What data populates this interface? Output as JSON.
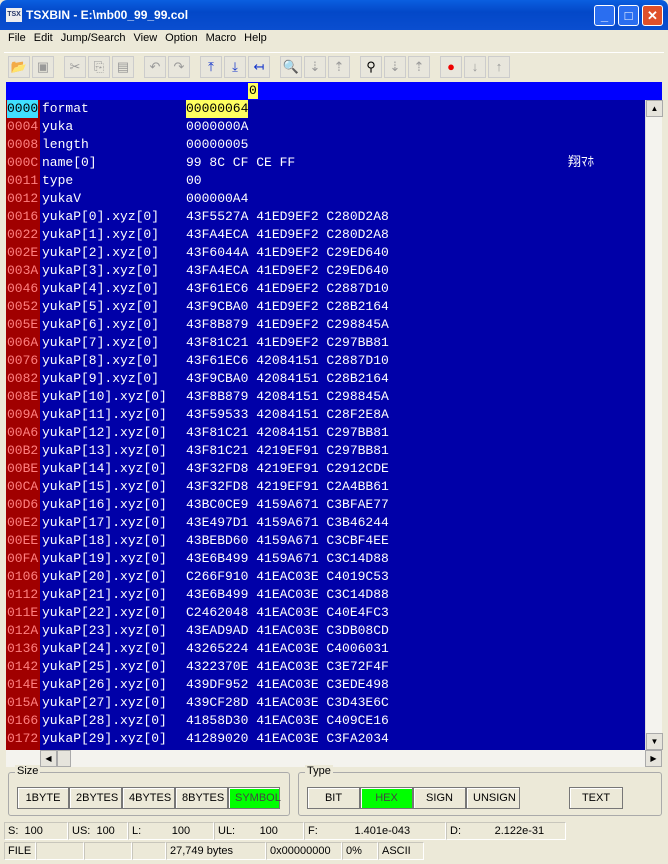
{
  "window": {
    "title": "TSXBIN - E:\\mb00_99_99.col",
    "logo": "TSX"
  },
  "menu": [
    "File",
    "Edit",
    "Jump/Search",
    "View",
    "Option",
    "Macro",
    "Help"
  ],
  "ruler": {
    "column": "0"
  },
  "rows": [
    {
      "addr": "0000",
      "name": "format",
      "value": "00000064"
    },
    {
      "addr": "0004",
      "name": "yuka",
      "value": "0000000A"
    },
    {
      "addr": "0008",
      "name": "length",
      "value": "00000005"
    },
    {
      "addr": "000C",
      "name": "name[0]",
      "value": "99 8C CF CE FF",
      "ascii": "翔ﾏﾎ"
    },
    {
      "addr": "0011",
      "name": "type",
      "value": "00"
    },
    {
      "addr": "0012",
      "name": "yukaV",
      "value": "000000A4"
    },
    {
      "addr": "0016",
      "name": "yukaP[0].xyz[0]",
      "value": "43F5527A 41ED9EF2 C280D2A8"
    },
    {
      "addr": "0022",
      "name": "yukaP[1].xyz[0]",
      "value": "43FA4ECA 41ED9EF2 C280D2A8"
    },
    {
      "addr": "002E",
      "name": "yukaP[2].xyz[0]",
      "value": "43F6044A 41ED9EF2 C29ED640"
    },
    {
      "addr": "003A",
      "name": "yukaP[3].xyz[0]",
      "value": "43FA4ECA 41ED9EF2 C29ED640"
    },
    {
      "addr": "0046",
      "name": "yukaP[4].xyz[0]",
      "value": "43F61EC6 41ED9EF2 C2887D10"
    },
    {
      "addr": "0052",
      "name": "yukaP[5].xyz[0]",
      "value": "43F9CBA0 41ED9EF2 C28B2164"
    },
    {
      "addr": "005E",
      "name": "yukaP[6].xyz[0]",
      "value": "43F8B879 41ED9EF2 C298845A"
    },
    {
      "addr": "006A",
      "name": "yukaP[7].xyz[0]",
      "value": "43F81C21 41ED9EF2 C297BB81"
    },
    {
      "addr": "0076",
      "name": "yukaP[8].xyz[0]",
      "value": "43F61EC6 42084151 C2887D10"
    },
    {
      "addr": "0082",
      "name": "yukaP[9].xyz[0]",
      "value": "43F9CBA0 42084151 C28B2164"
    },
    {
      "addr": "008E",
      "name": "yukaP[10].xyz[0]",
      "value": "43F8B879 42084151 C298845A"
    },
    {
      "addr": "009A",
      "name": "yukaP[11].xyz[0]",
      "value": "43F59533 42084151 C28F2E8A"
    },
    {
      "addr": "00A6",
      "name": "yukaP[12].xyz[0]",
      "value": "43F81C21 42084151 C297BB81"
    },
    {
      "addr": "00B2",
      "name": "yukaP[13].xyz[0]",
      "value": "43F81C21 4219EF91 C297BB81"
    },
    {
      "addr": "00BE",
      "name": "yukaP[14].xyz[0]",
      "value": "43F32FD8 4219EF91 C2912CDE"
    },
    {
      "addr": "00CA",
      "name": "yukaP[15].xyz[0]",
      "value": "43F32FD8 4219EF91 C2A4BB61"
    },
    {
      "addr": "00D6",
      "name": "yukaP[16].xyz[0]",
      "value": "43BC0CE9 4159A671 C3BFAE77"
    },
    {
      "addr": "00E2",
      "name": "yukaP[17].xyz[0]",
      "value": "43E497D1 4159A671 C3B46244"
    },
    {
      "addr": "00EE",
      "name": "yukaP[18].xyz[0]",
      "value": "43BEBD60 4159A671 C3CBF4EE"
    },
    {
      "addr": "00FA",
      "name": "yukaP[19].xyz[0]",
      "value": "43E6B499 4159A671 C3C14D88"
    },
    {
      "addr": "0106",
      "name": "yukaP[20].xyz[0]",
      "value": "C266F910 41EAC03E C4019C53"
    },
    {
      "addr": "0112",
      "name": "yukaP[21].xyz[0]",
      "value": "43E6B499 41EAC03E C3C14D88"
    },
    {
      "addr": "011E",
      "name": "yukaP[22].xyz[0]",
      "value": "C2462048 41EAC03E C40E4FC3"
    },
    {
      "addr": "012A",
      "name": "yukaP[23].xyz[0]",
      "value": "43EAD9AD 41EAC03E C3DB08CD"
    },
    {
      "addr": "0136",
      "name": "yukaP[24].xyz[0]",
      "value": "43265224 41EAC03E C4006031"
    },
    {
      "addr": "0142",
      "name": "yukaP[25].xyz[0]",
      "value": "4322370E 41EAC03E C3E72F4F"
    },
    {
      "addr": "014E",
      "name": "yukaP[26].xyz[0]",
      "value": "439DF952 41EAC03E C3EDE498"
    },
    {
      "addr": "015A",
      "name": "yukaP[27].xyz[0]",
      "value": "439CF28D 41EAC03E C3D43E6C"
    },
    {
      "addr": "0166",
      "name": "yukaP[28].xyz[0]",
      "value": "41858D30 41EAC03E C409CE16"
    },
    {
      "addr": "0172",
      "name": "yukaP[29].xyz[0]",
      "value": "41289020 41EAC03E C3FA2034"
    }
  ],
  "size_group": {
    "label": "Size",
    "buttons": [
      "1BYTE",
      "2BYTES",
      "4BYTES",
      "8BYTES",
      "SYMBOL"
    ],
    "selected": "SYMBOL"
  },
  "type_group": {
    "label": "Type",
    "buttons": [
      "BIT",
      "HEX",
      "SIGN",
      "UNSIGN"
    ],
    "selected": "HEX",
    "text_button": "TEXT"
  },
  "status1": {
    "s": "S:  100",
    "us": "US:  100",
    "l": "L:          100",
    "ul": "UL:        100",
    "f": "F:            1.401e-043",
    "d": "D:           2.122e-31"
  },
  "status2": {
    "mode": "FILE",
    "size": "27,749 bytes",
    "offset": "0x00000000",
    "percent": "0%",
    "encoding": "ASCII"
  },
  "colors": {
    "grid_bg": "#0000a8",
    "addr_bg": "#a00000",
    "highlight": "#ffff60",
    "selected_button": "#00ff00"
  }
}
